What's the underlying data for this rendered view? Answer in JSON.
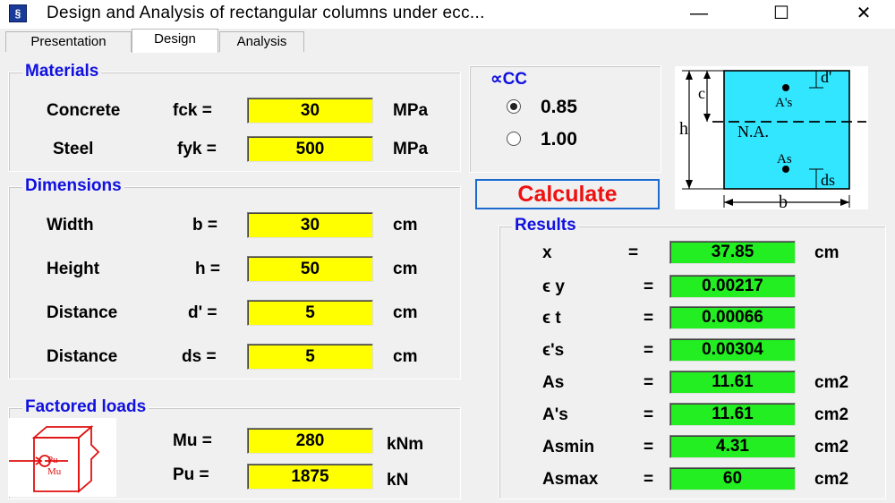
{
  "window": {
    "title": "Design and Analysis of rectangular columns under ecc...",
    "icon_glyph": "§",
    "minimize": "—",
    "maximize": "☐",
    "close": "✕"
  },
  "tabs": [
    {
      "label": "Presentation",
      "active": false
    },
    {
      "label": "Design",
      "active": true
    },
    {
      "label": "Analysis",
      "active": false
    }
  ],
  "materials": {
    "title": "Materials",
    "concrete": {
      "label": "Concrete",
      "symbol": "fck =",
      "value": "30",
      "unit": "MPa"
    },
    "steel": {
      "label": "Steel",
      "symbol": "fyk =",
      "value": "500",
      "unit": "MPa"
    }
  },
  "dimensions": {
    "title": "Dimensions",
    "rows": [
      {
        "label": "Width",
        "symbol": "b =",
        "value": "30",
        "unit": "cm"
      },
      {
        "label": "Height",
        "symbol": "h =",
        "value": "50",
        "unit": "cm"
      },
      {
        "label": "Distance",
        "symbol": "d' =",
        "value": "5",
        "unit": "cm"
      },
      {
        "label": "Distance",
        "symbol": "ds =",
        "value": "5",
        "unit": "cm"
      }
    ]
  },
  "loads": {
    "title": "Factored loads",
    "rows": [
      {
        "symbol": "Mu =",
        "value": "280",
        "unit": "kNm"
      },
      {
        "symbol": "Pu =",
        "value": "1875",
        "unit": "kN"
      }
    ]
  },
  "alpha_cc": {
    "title": "∝CC",
    "options": [
      {
        "label": "0.85",
        "checked": true
      },
      {
        "label": "1.00",
        "checked": false
      }
    ]
  },
  "calculate_label": "Calculate",
  "section_diagram": {
    "c": "c",
    "h": "h",
    "b": "b",
    "d_prime": "d'",
    "ds": "ds",
    "na": "N.A.",
    "as_prime": "A's",
    "as": "As",
    "fill_color": "#33e6ff"
  },
  "results": {
    "title": "Results",
    "rows": [
      {
        "label": "x",
        "eq": "=",
        "value": "37.85",
        "unit": "cm"
      },
      {
        "label": "ϵ y",
        "eq": "=",
        "value": "0.00217",
        "unit": ""
      },
      {
        "label": "ϵ t",
        "eq": "=",
        "value": "0.00066",
        "unit": ""
      },
      {
        "label": "ϵ's",
        "eq": "=",
        "value": "0.00304",
        "unit": ""
      },
      {
        "label": "As",
        "eq": "=",
        "value": "11.61",
        "unit": "cm2"
      },
      {
        "label": "A's",
        "eq": "=",
        "value": "11.61",
        "unit": "cm2"
      },
      {
        "label": "Asmin",
        "eq": "=",
        "value": "4.31",
        "unit": "cm2"
      },
      {
        "label": "Asmax",
        "eq": "=",
        "value": "60",
        "unit": "cm2"
      }
    ]
  },
  "colors": {
    "input_bg": "#ffff00",
    "result_bg": "#22ee22",
    "panel_title": "#1010e0",
    "calculate_text": "#ee1111"
  }
}
